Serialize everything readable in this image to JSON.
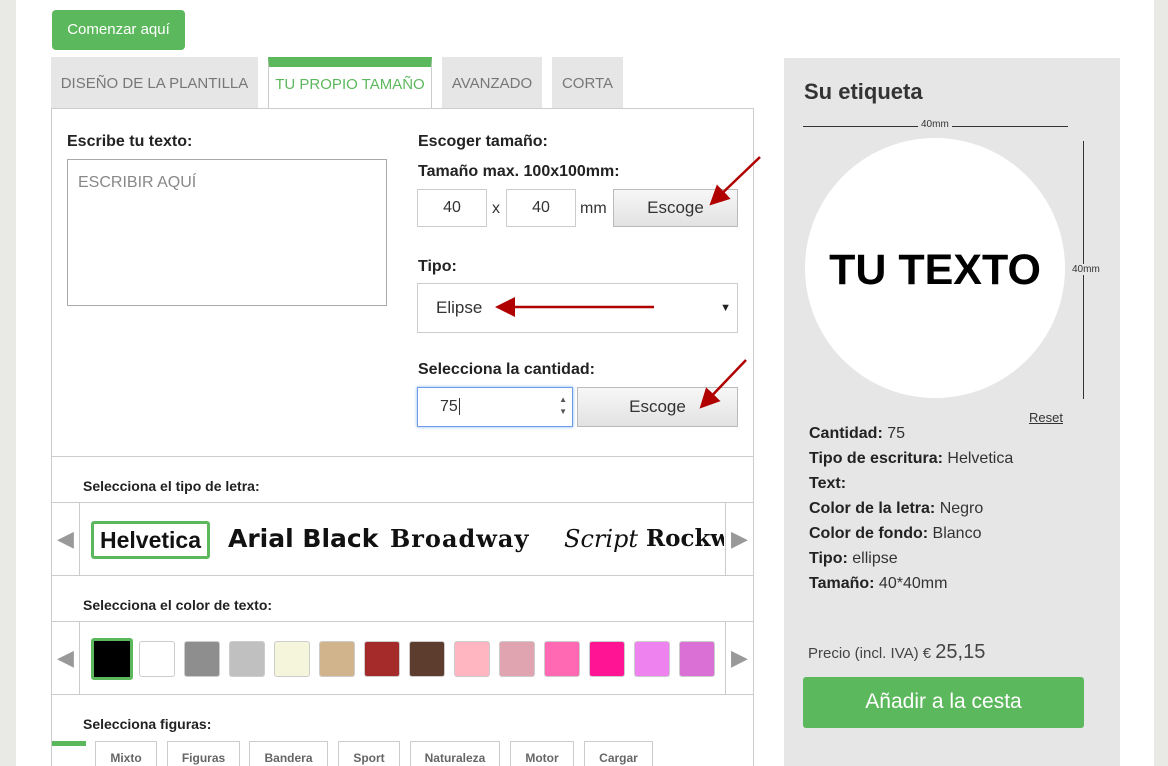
{
  "start_button": "Comenzar aquí",
  "tabs": [
    {
      "label": "DISEÑO DE LA PLANTILLA"
    },
    {
      "label": "TU PROPIO TAMAÑO"
    },
    {
      "label": "AVANZADO"
    },
    {
      "label": "CORTA"
    }
  ],
  "text_section": {
    "label": "Escribe tu texto:",
    "placeholder": "ESCRIBIR AQUÍ"
  },
  "size_section": {
    "label": "Escoger tamaño:",
    "max_label": "Tamaño max. 100x100mm:",
    "width": "40",
    "separator": "x",
    "height": "40",
    "unit": "mm",
    "button": "Escoge"
  },
  "type_section": {
    "label": "Tipo:",
    "selected": "Elipse",
    "caret": "▼"
  },
  "quantity_section": {
    "label": "Selecciona la cantidad:",
    "value": "75",
    "button": "Escoge"
  },
  "font_section": {
    "label": "Selecciona el tipo de letra:",
    "fonts": [
      "Helvetica",
      "Arial Black",
      "Broadway",
      "Script",
      "Rockwe"
    ]
  },
  "color_section": {
    "label": "Selecciona el color de texto:",
    "colors": [
      "#000000",
      "#ffffff",
      "#8e8e8e",
      "#c0c0c0",
      "#f5f5dc",
      "#d2b48c",
      "#a52a2a",
      "#5c3d2e",
      "#ffb6c1",
      "#e0a3b0",
      "#ff69b4",
      "#ff1493",
      "#ee82ee",
      "#da70d6",
      "#cc00cc"
    ]
  },
  "shapes_section": {
    "label": "Selecciona figuras:",
    "tabs": [
      "Mixto",
      "Figuras",
      "Bandera",
      "Sport",
      "Naturaleza",
      "Motor",
      "Cargar"
    ]
  },
  "arrows": {
    "left": "◀",
    "right": "▶"
  },
  "sidebar": {
    "title": "Su etiqueta",
    "width_dim": "40mm",
    "height_dim": "40mm",
    "preview_text": "TU TEXTO",
    "reset": "Reset",
    "details": [
      {
        "key": "Cantidad:",
        "value": " 75"
      },
      {
        "key": "Tipo de escritura:",
        "value": " Helvetica"
      },
      {
        "key": "Text:",
        "value": ""
      },
      {
        "key": "Color de la letra:",
        "value": " Negro"
      },
      {
        "key": "Color de fondo:",
        "value": " Blanco"
      },
      {
        "key": "Tipo:",
        "value": " ellipse"
      },
      {
        "key": "Tamaño:",
        "value": " 40*40mm"
      }
    ],
    "price_label": "Precio (incl. IVA) €",
    "price": "25,15",
    "add_button": "Añadir a la cesta"
  }
}
